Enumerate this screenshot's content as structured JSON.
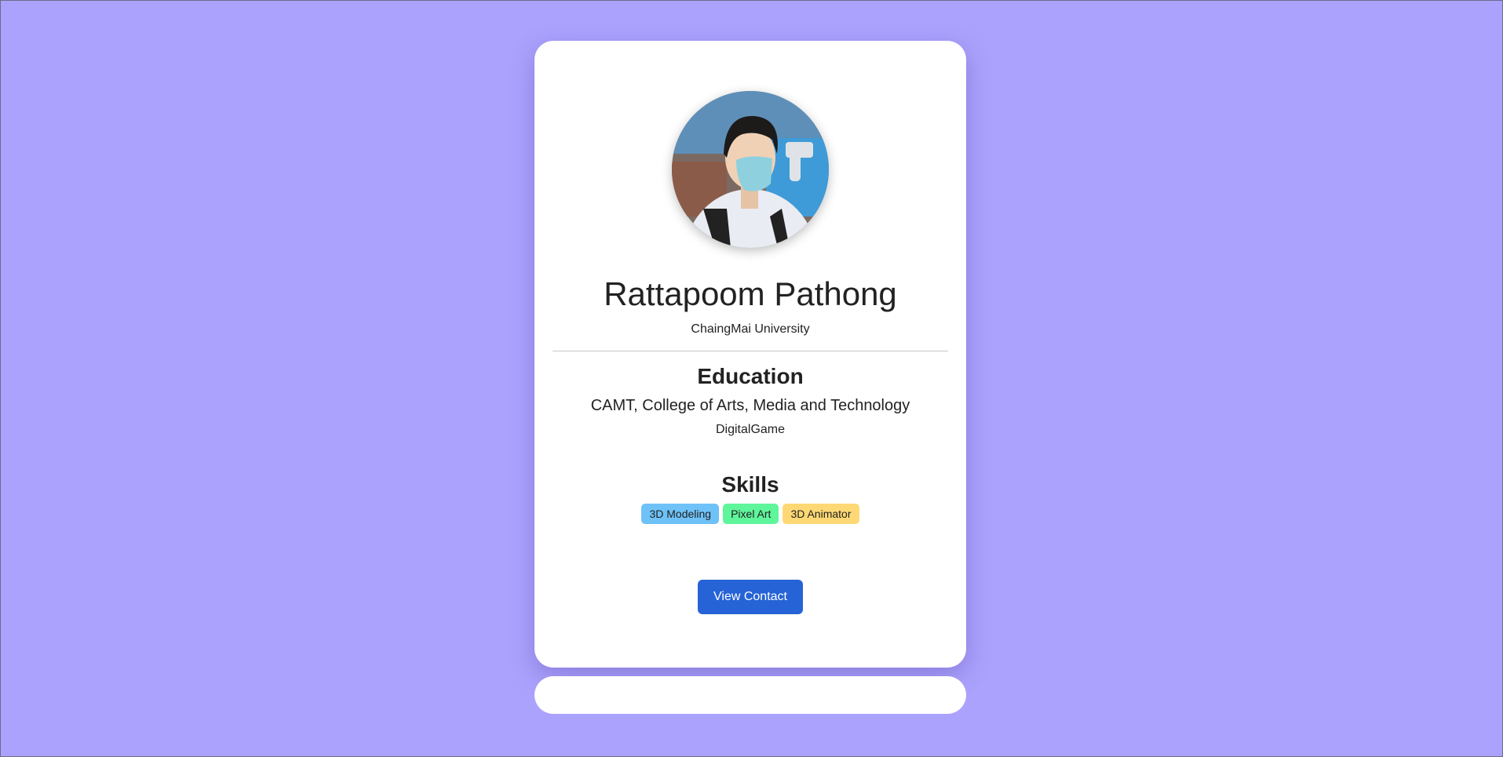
{
  "profile": {
    "name": "Rattapoom Pathong",
    "university": "ChaingMai University"
  },
  "education": {
    "title": "Education",
    "school": "CAMT, College of Arts, Media and Technology",
    "major": "DigitalGame"
  },
  "skills": {
    "title": "Skills",
    "items": [
      {
        "label": "3D Modeling",
        "color": "#6ec2f7"
      },
      {
        "label": "Pixel Art",
        "color": "#5ff59b"
      },
      {
        "label": "3D Animator",
        "color": "#fdd874"
      }
    ]
  },
  "actions": {
    "view_contact_label": "View Contact"
  },
  "theme": {
    "background": "#aba2fd",
    "card": "#ffffff",
    "button": "#2563d6"
  }
}
